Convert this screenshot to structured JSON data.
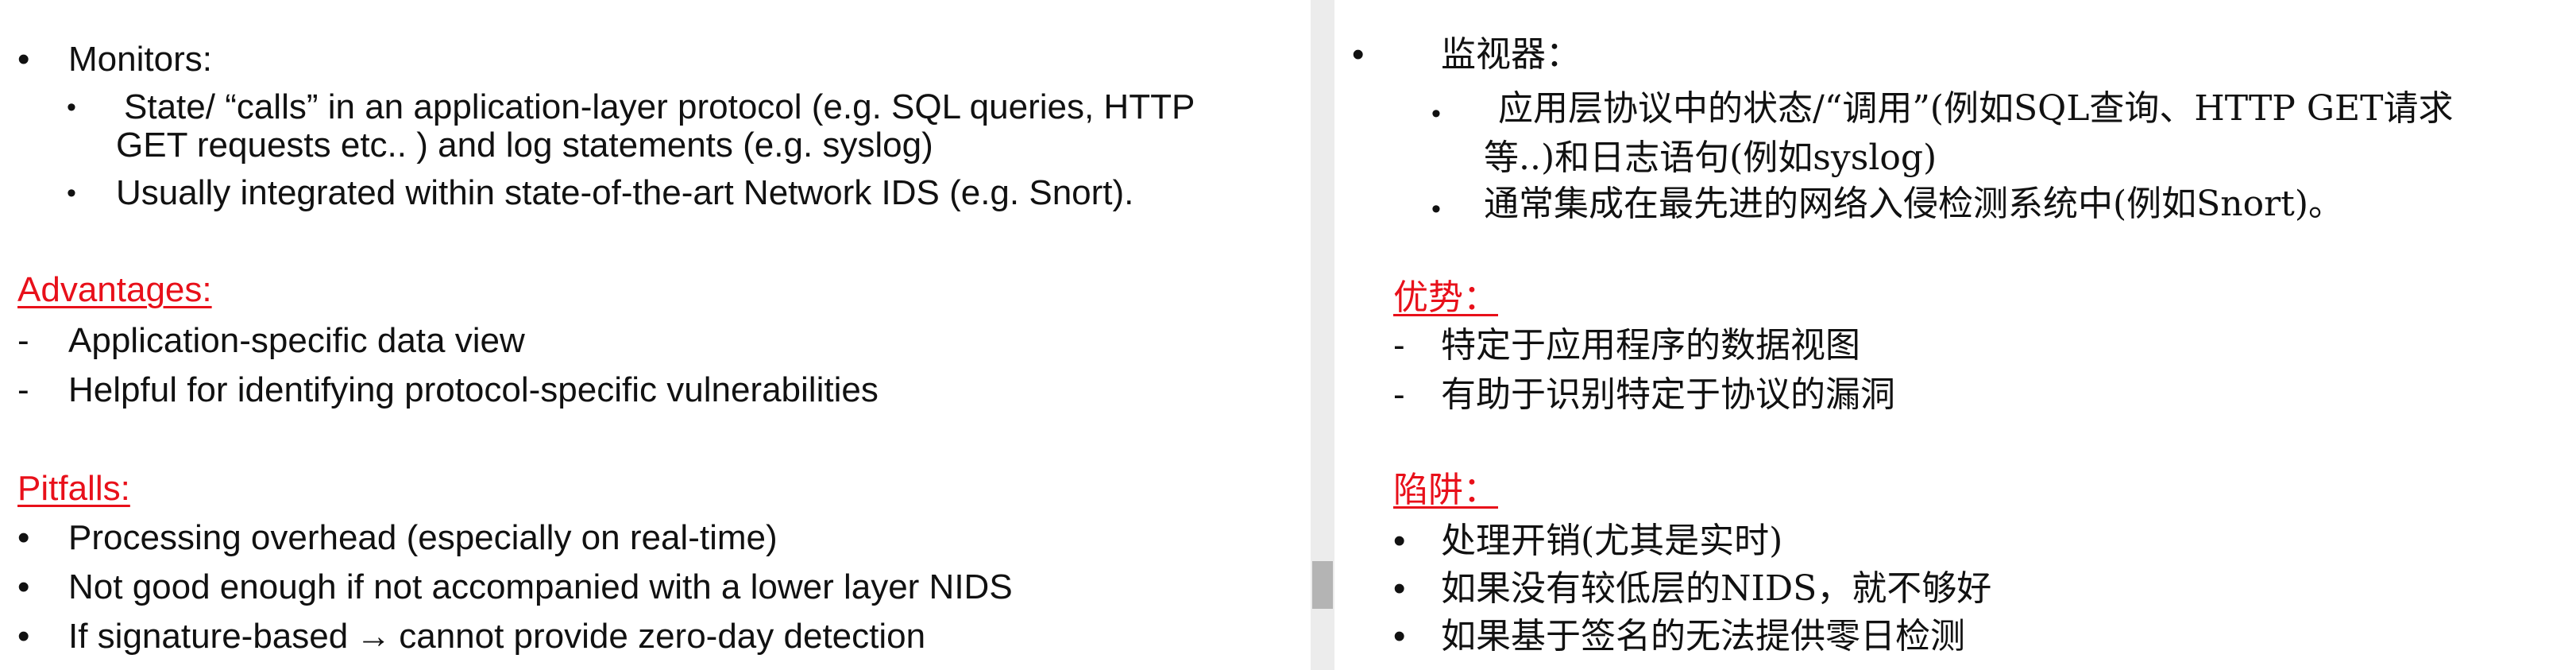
{
  "english": {
    "monitors_label": "Monitors:",
    "sub1_line1": "State/ “calls” in an application-layer protocol (e.g. SQL queries, HTTP",
    "sub1_line2": "GET requests etc.. ) and log statements (e.g. syslog)",
    "sub2": "Usually integrated within state-of-the-art Network IDS (e.g. Snort).",
    "advantages_heading": "Advantages:",
    "advantages": [
      "Application-specific data view",
      "Helpful for identifying protocol-specific vulnerabilities"
    ],
    "pitfalls_heading": "Pitfalls:",
    "pitfall1": "Processing overhead (especially on real-time)",
    "pitfall2": "Not good enough if not accompanied with a lower layer NIDS",
    "pitfall3_a": "If signature-based",
    "pitfall3_arrow": "→",
    "pitfall3_b": "cannot provide zero-day detection"
  },
  "chinese": {
    "monitors_label": "监视器：",
    "sub1_line1": "应用层协议中的状态/“调用”(例如SQL查询、HTTP GET请求",
    "sub1_line2": "等..)和日志语句(例如syslog)",
    "sub2": "通常集成在最先进的网络入侵检测系统中(例如Snort)。",
    "advantages_heading": "优势：",
    "advantages": [
      "特定于应用程序的数据视图",
      "有助于识别特定于协议的漏洞"
    ],
    "pitfalls_heading": "陷阱：",
    "pitfalls": [
      "处理开销(尤其是实时)",
      "如果没有较低层的NIDS，就不够好",
      "如果基于签名的无法提供零日检测"
    ]
  },
  "markers": {
    "bullet": "•",
    "dash": "-"
  },
  "colors": {
    "heading": "#e8101a",
    "text": "#111111",
    "divider": "#ececec",
    "scroll_thumb": "#b4b4b4"
  }
}
